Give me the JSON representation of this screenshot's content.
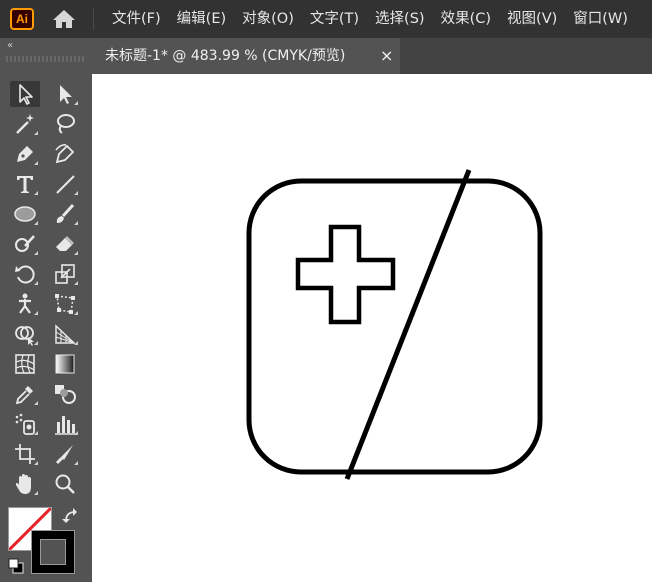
{
  "app": {
    "logo_text": "Ai"
  },
  "menu": {
    "items": [
      "文件(F)",
      "编辑(E)",
      "对象(O)",
      "文字(T)",
      "选择(S)",
      "效果(C)",
      "视图(V)",
      "窗口(W)"
    ]
  },
  "toolbar": {
    "collapse_glyph": "«",
    "tools": [
      "selection-tool",
      "direct-selection-tool",
      "magic-wand-tool",
      "lasso-tool",
      "pen-tool",
      "curvature-tool",
      "type-tool",
      "line-segment-tool",
      "ellipse-tool",
      "paintbrush-tool",
      "shaper-tool",
      "eraser-tool",
      "rotate-tool",
      "scale-tool",
      "puppet-warp-tool",
      "free-transform-tool",
      "shape-builder-tool",
      "perspective-grid-tool",
      "mesh-tool",
      "gradient-tool",
      "eyedropper-tool",
      "blend-tool",
      "symbol-sprayer-tool",
      "column-graph-tool",
      "artboard-tool",
      "slice-tool",
      "hand-tool",
      "zoom-tool"
    ],
    "fill_color": "none",
    "stroke_color": "#000000"
  },
  "document": {
    "tab_title": "未标题-1* @ 483.99 % (CMYK/预览)",
    "close_glyph": "×"
  },
  "colors": {
    "menubar_bg": "#323232",
    "panel_bg": "#535353",
    "canvas_bg": "#ffffff",
    "brand_orange": "#ff9a00",
    "artwork_stroke": "#000000"
  }
}
